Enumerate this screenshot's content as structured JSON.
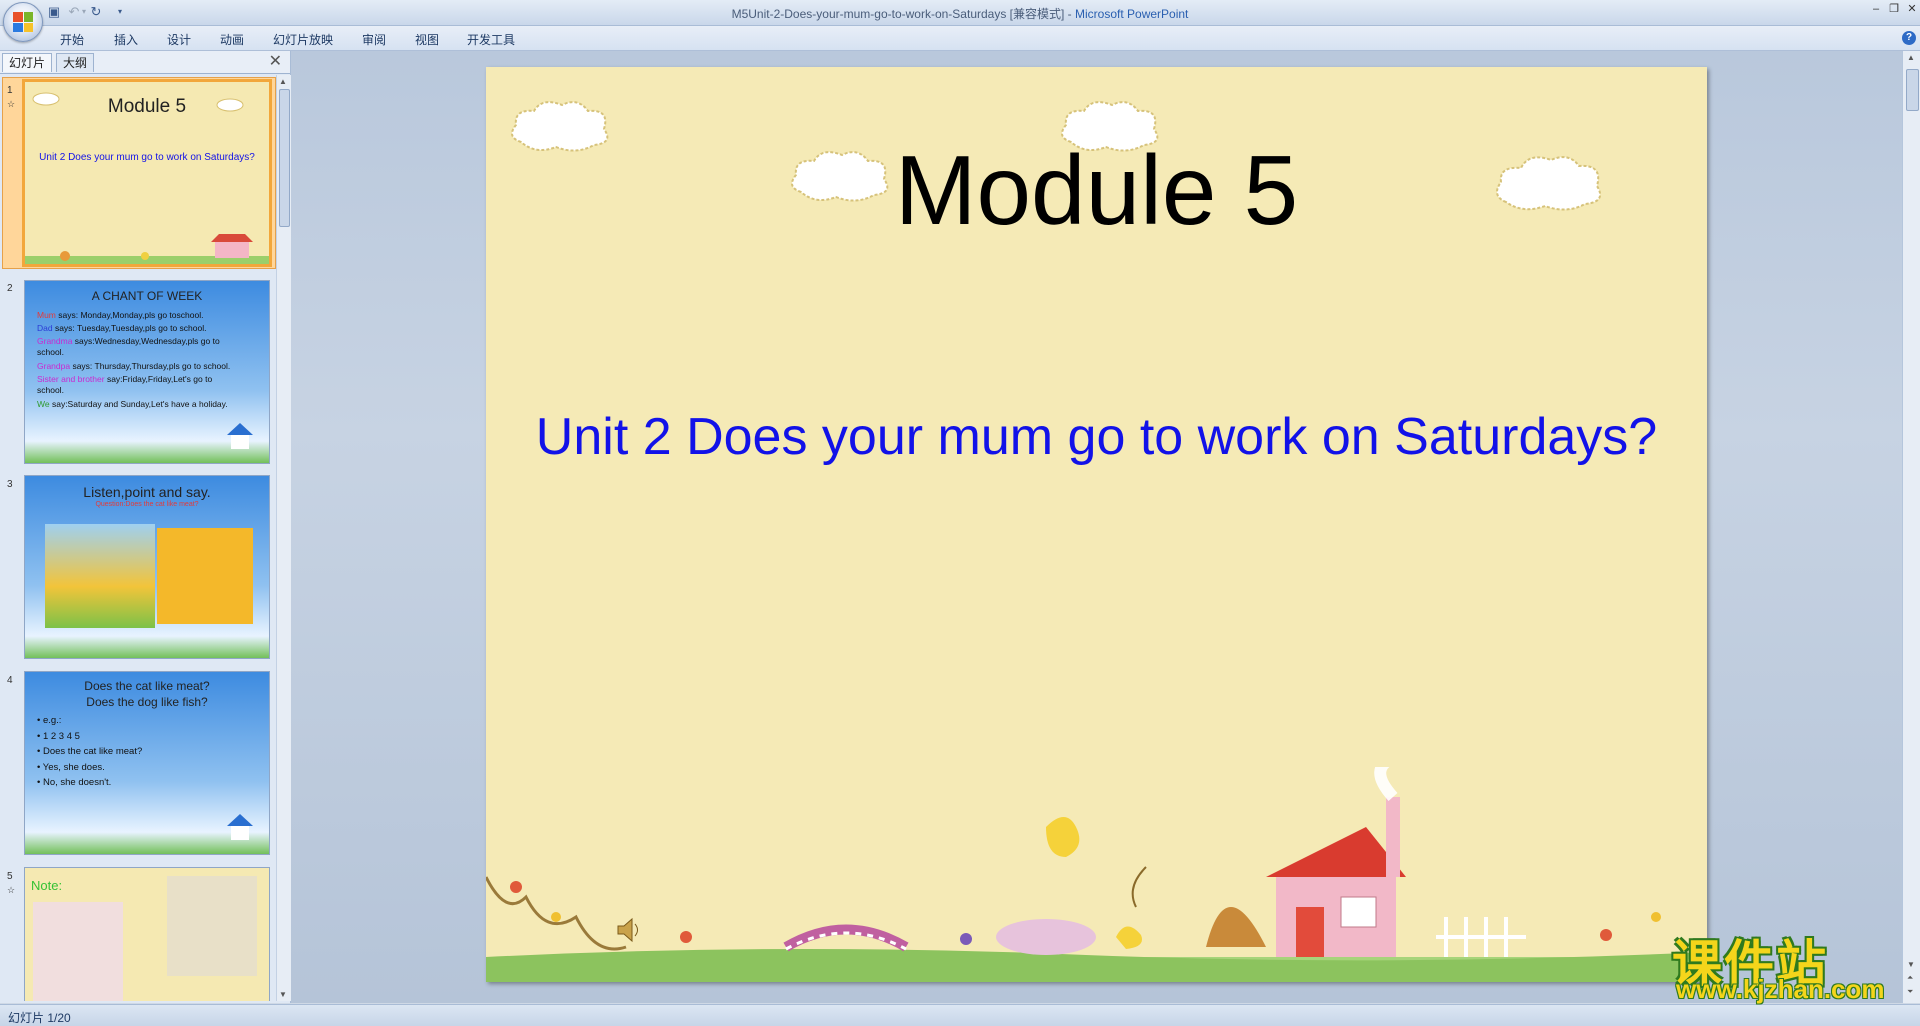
{
  "window": {
    "title_doc": "M5Unit-2-Does-your-mum-go-to-work-on-Saturdays [兼容模式] - ",
    "title_app": "Microsoft PowerPoint"
  },
  "ribbon": {
    "tabs": [
      "开始",
      "插入",
      "设计",
      "动画",
      "幻灯片放映",
      "审阅",
      "视图",
      "开发工具"
    ]
  },
  "left_panel": {
    "tabs": [
      "幻灯片",
      "大纲"
    ],
    "slide_numbers": [
      "1",
      "2",
      "3",
      "4",
      "5"
    ],
    "thumb1": {
      "title": "Module 5",
      "subtitle": "Unit 2 Does your mum go to work on Saturdays?"
    },
    "thumb2": {
      "title": "A CHANT OF WEEK",
      "lines": [
        {
          "who": "Mum",
          "text": " says: Monday,Monday,pls go toschool."
        },
        {
          "who": "Dad",
          "text": "  says: Tuesday,Tuesday,pls go to school."
        },
        {
          "who": "Grandma",
          "text": "  says:Wednesday,Wednesday,pls go to"
        },
        {
          "who": "",
          "text": "       school."
        },
        {
          "who": "Grandpa",
          "text": "   says: Thursday,Thursday,pls go to school."
        },
        {
          "who": "Sister and brother",
          "text": " say:Friday,Friday,Let's go to"
        },
        {
          "who": "",
          "text": "       school."
        },
        {
          "who": "We",
          "text": " say:Saturday and Sunday,Let's have a holiday."
        }
      ]
    },
    "thumb3": {
      "title": "Listen,point and say.",
      "question": "Question:Does the cat like meat?"
    },
    "thumb4": {
      "title1": "Does the cat like meat?",
      "title2": "Does the dog like fish?",
      "bullets": [
        "• e.g.:",
        "•  1      2      3      4      5",
        "• Does  the  cat    like    meat?",
        "• Yes, she does.",
        "• No,  she doesn't."
      ]
    },
    "thumb5": {
      "note": "Note:"
    }
  },
  "slide": {
    "title": "Module 5",
    "subtitle": "Unit 2 Does your mum go to work on Saturdays?"
  },
  "status": {
    "text": "幻灯片 1/20"
  },
  "watermark": {
    "cn": "课件站",
    "url": "www.kjzhan.com"
  },
  "colors": {
    "accent": "#2a5fb0",
    "slide_bg": "#f5eab6",
    "subtitle": "#1212e8",
    "selection": "#f2a73b"
  }
}
